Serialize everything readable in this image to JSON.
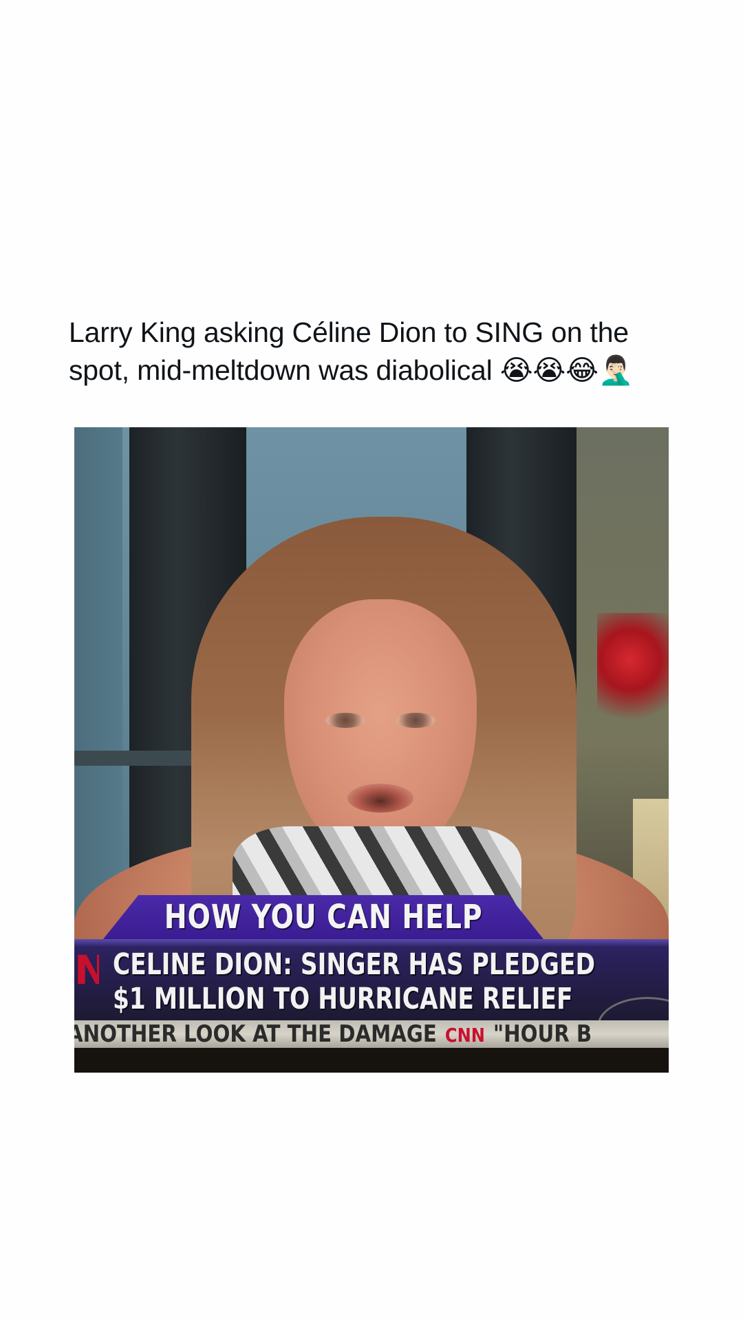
{
  "post": {
    "caption_line1": "Larry King asking Céline Dion to SING on the",
    "caption_line2": "spot, mid-meltdown was diabolical 😭😭😂🤦🏻‍♂️"
  },
  "video": {
    "lower_third_tab": "HOW YOU CAN HELP",
    "headline_line1": "CELINE DION: SINGER HAS PLEDGED",
    "headline_line2": "$1 MILLION TO HURRICANE RELIEF",
    "ticker_left": "ANOTHER LOOK AT THE DAMAGE",
    "ticker_logo": "CNN",
    "ticker_right": "\"HOUR B",
    "logo_fragment": "N"
  }
}
